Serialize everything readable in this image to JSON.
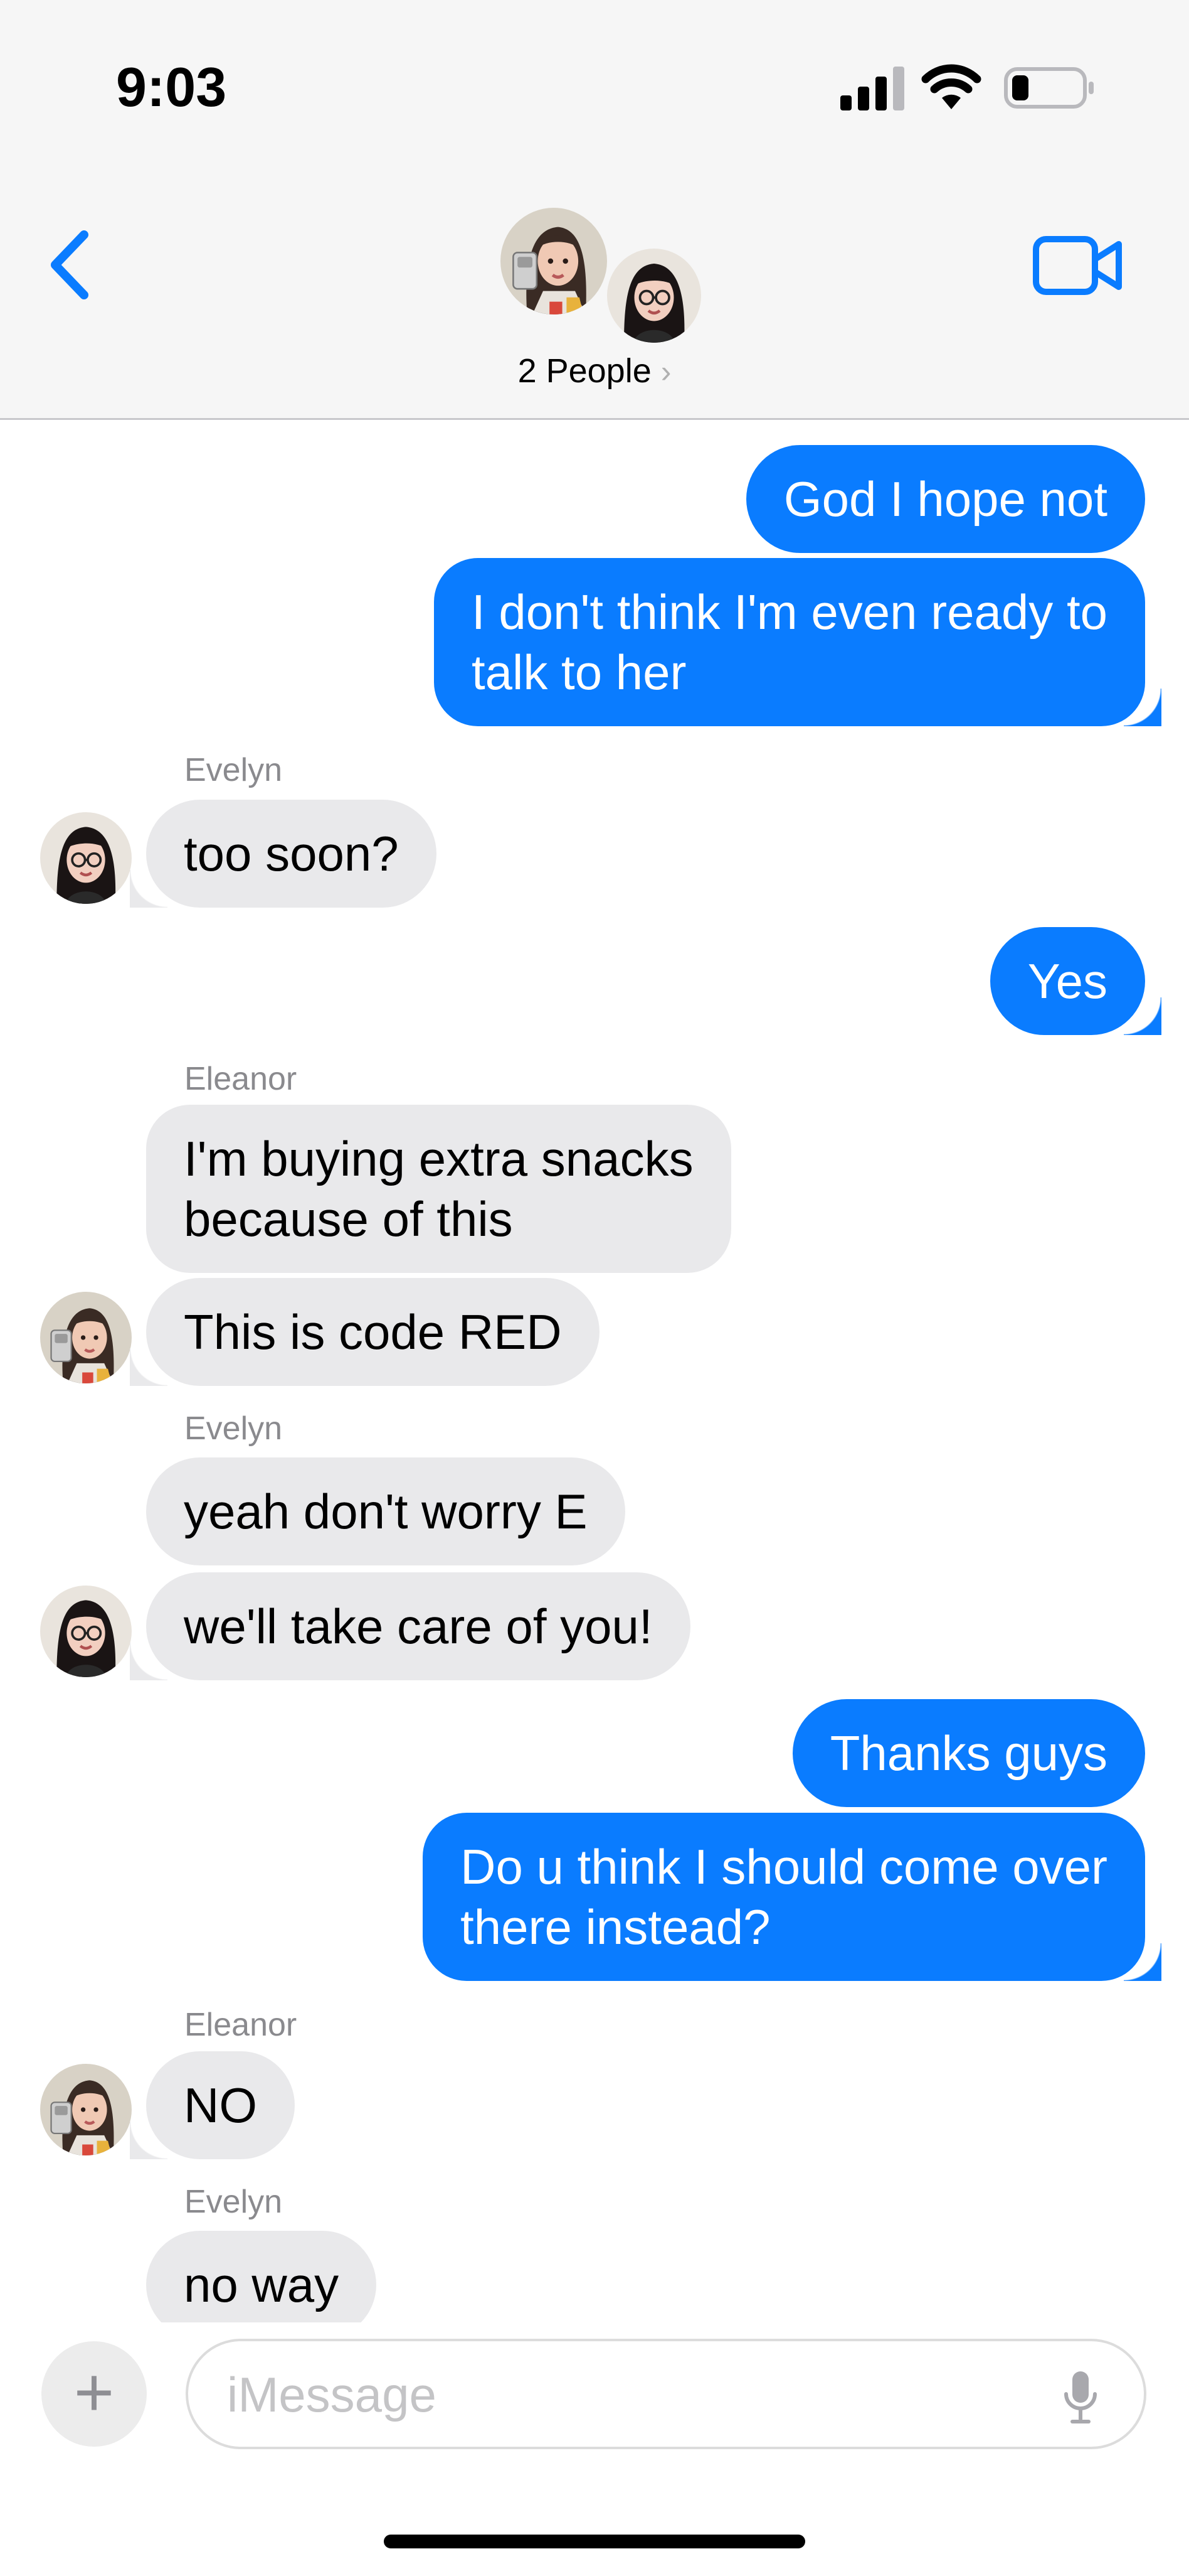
{
  "status_bar": {
    "time": "9:03"
  },
  "header": {
    "title": "2 People",
    "chevron": "›"
  },
  "messages": [
    {
      "text": "God I hope not"
    },
    {
      "text": "I don't think I'm even ready to",
      "text2": "talk to her"
    },
    {
      "sender": "Evelyn",
      "text": "too soon?"
    },
    {
      "text": "Yes"
    },
    {
      "sender": "Eleanor",
      "text": "I'm buying extra snacks",
      "text2": "because of this"
    },
    {
      "text": "This is code RED"
    },
    {
      "sender": "Evelyn",
      "text": "yeah don't worry E"
    },
    {
      "text": "we'll take care of you!"
    },
    {
      "text": "Thanks guys"
    },
    {
      "text": "Do u think I should come over",
      "text2": "there instead?"
    },
    {
      "sender": "Eleanor",
      "text": "NO"
    },
    {
      "sender": "Evelyn",
      "text": "no way"
    }
  ],
  "composer": {
    "plus": "+",
    "placeholder": "iMessage"
  },
  "colors": {
    "outgoing": "#0a7cff",
    "incoming": "#e9e9eb",
    "accent": "#0a7cff"
  },
  "icons": [
    "back-chevron-icon",
    "video-camera-icon",
    "signal-icon",
    "wifi-icon",
    "battery-icon",
    "plus-icon",
    "mic-icon"
  ]
}
